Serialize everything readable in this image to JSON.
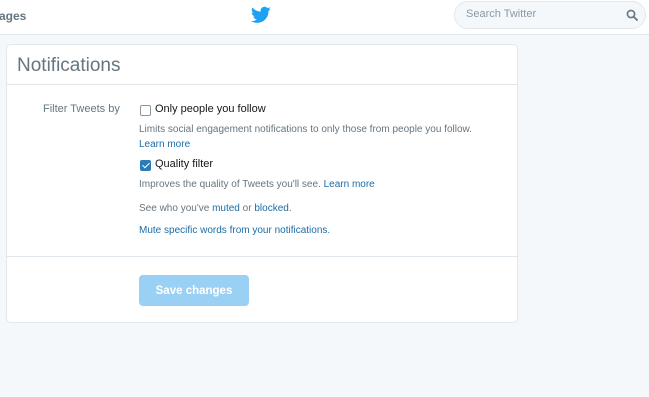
{
  "topbar": {
    "nav_partial_label": "ages",
    "search": {
      "placeholder": "Search Twitter"
    }
  },
  "notifications": {
    "title": "Notifications",
    "filter_label": "Filter Tweets by",
    "options": [
      {
        "label": "Only people you follow",
        "checked": false,
        "description": "Limits social engagement notifications to only those from people you follow.",
        "link": "Learn more"
      },
      {
        "label": "Quality filter",
        "checked": true,
        "description": "Improves the quality of Tweets you'll see.",
        "link": "Learn more"
      }
    ],
    "muted_blocked": {
      "prefix": "See who you've",
      "muted_link": "muted",
      "middle": "or",
      "blocked_link": "blocked",
      "suffix": "."
    },
    "mute_words_link": "Mute specific words from your notifications.",
    "save_button": "Save changes"
  },
  "colors": {
    "link": "#1b6ca8",
    "checkbox_checked": "#2b7bb9",
    "save_button_disabled": "#9ad0f4",
    "twitter_blue": "#1da1f2"
  },
  "icons": {
    "logo": "twitter-bird-icon",
    "search": "search-icon"
  }
}
